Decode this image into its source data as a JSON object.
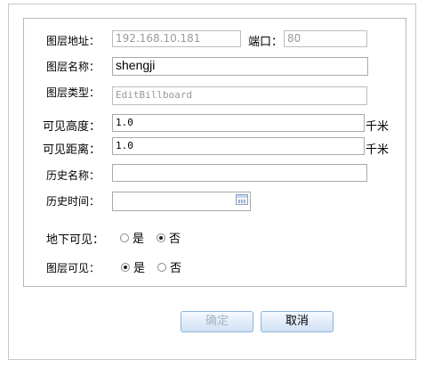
{
  "form": {
    "address_label": "图层地址：",
    "address_value": "192.168.10.181",
    "port_label": "端口：",
    "port_value": "80",
    "name_label": "图层名称：",
    "name_value": "shengji",
    "type_label": "图层类型：",
    "type_value": "EditBillboard",
    "visible_height_label": "可见高度：",
    "visible_height_value": "1.0",
    "visible_height_unit": "千米",
    "visible_distance_label": "可见距离：",
    "visible_distance_value": "1.0",
    "visible_distance_unit": "千米",
    "history_name_label": "历史名称：",
    "history_name_value": "",
    "history_time_label": "历史时间：",
    "history_time_value": "",
    "underground_label": "地下可见：",
    "underground_options": [
      {
        "label": "是",
        "checked": false
      },
      {
        "label": "否",
        "checked": true
      }
    ],
    "layer_visible_label": "图层可见：",
    "layer_visible_options": [
      {
        "label": "是",
        "checked": true
      },
      {
        "label": "否",
        "checked": false
      }
    ]
  },
  "buttons": {
    "confirm_label": "确定",
    "cancel_label": "取消"
  }
}
